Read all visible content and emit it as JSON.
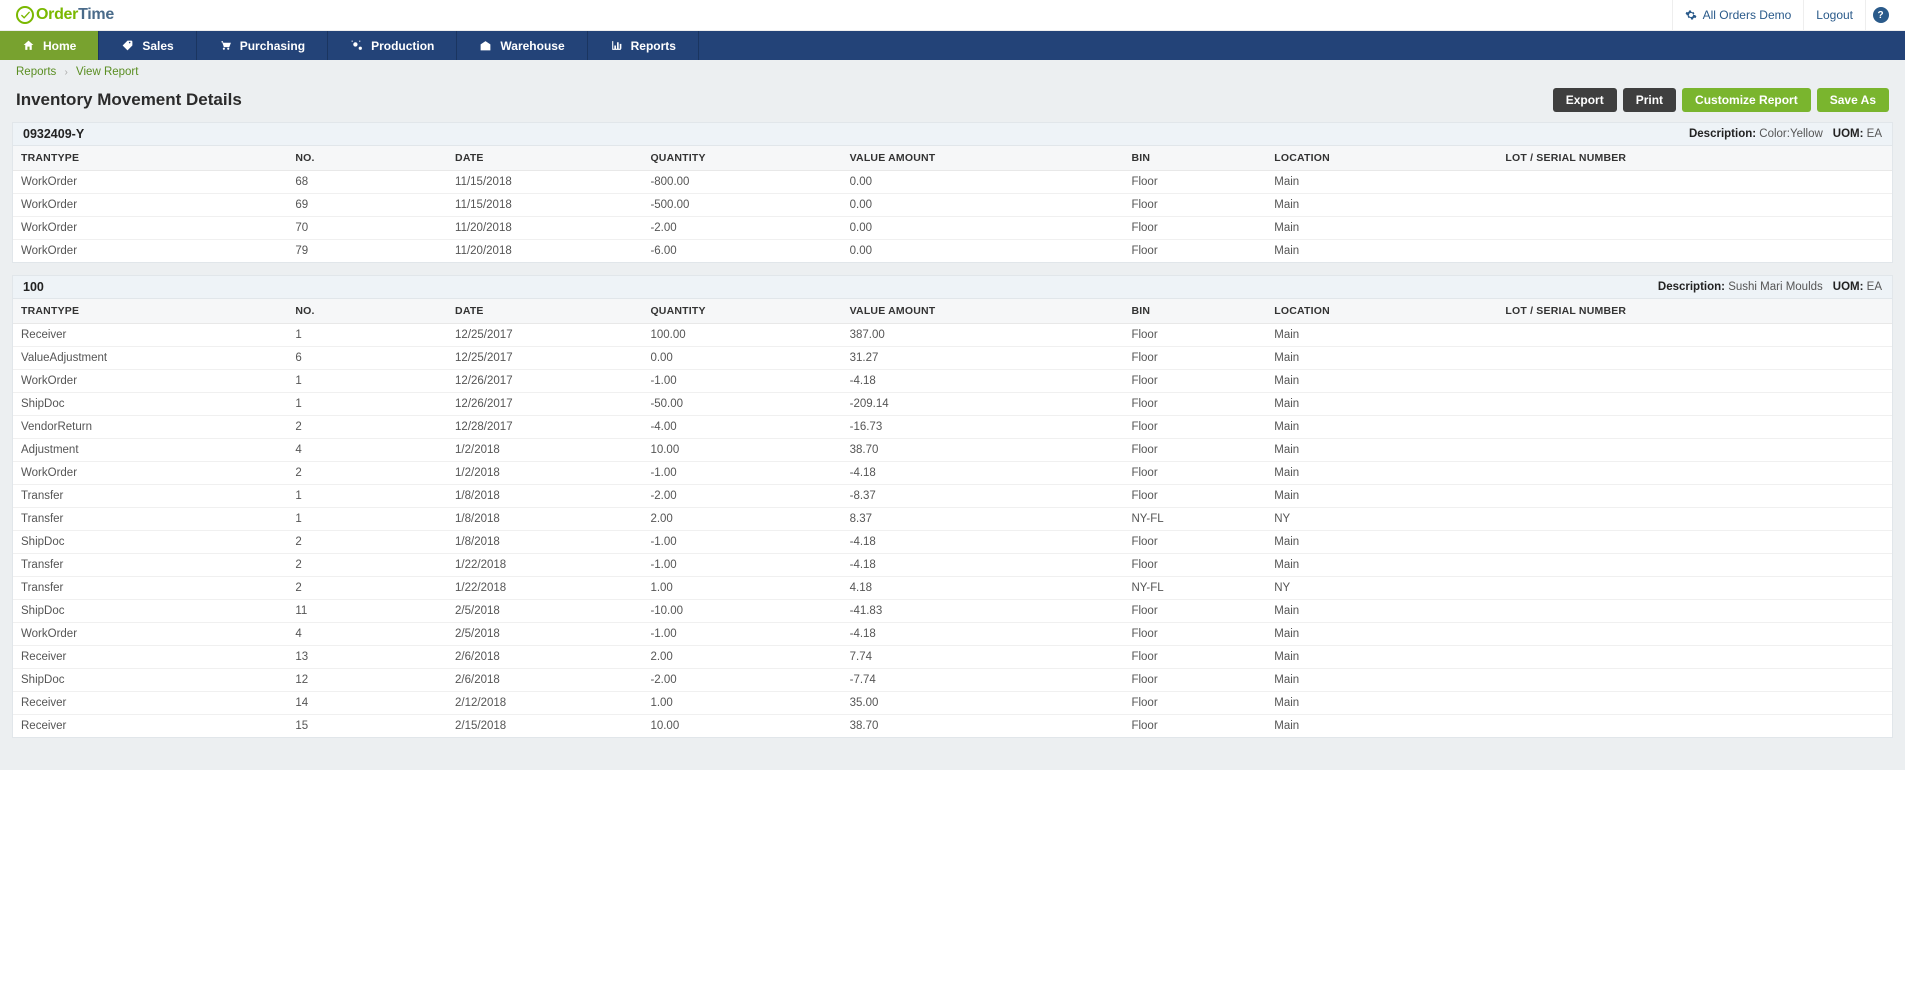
{
  "brand": {
    "part1": "Order",
    "part2": "Time"
  },
  "header": {
    "demo_label": "All Orders Demo",
    "logout_label": "Logout"
  },
  "nav": [
    {
      "id": "home",
      "label": "Home",
      "icon": "home",
      "active": true
    },
    {
      "id": "sales",
      "label": "Sales",
      "icon": "tag",
      "active": false
    },
    {
      "id": "purchasing",
      "label": "Purchasing",
      "icon": "cart",
      "active": false
    },
    {
      "id": "production",
      "label": "Production",
      "icon": "gears",
      "active": false
    },
    {
      "id": "warehouse",
      "label": "Warehouse",
      "icon": "warehouse",
      "active": false
    },
    {
      "id": "reports",
      "label": "Reports",
      "icon": "chart",
      "active": false
    }
  ],
  "breadcrumb": {
    "root": "Reports",
    "current": "View Report"
  },
  "page_title": "Inventory Movement Details",
  "buttons": {
    "export": "Export",
    "print": "Print",
    "customize": "Customize Report",
    "save_as": "Save As"
  },
  "columns": {
    "trantype": "TRANTYPE",
    "no": "NO.",
    "date": "DATE",
    "qty": "QUANTITY",
    "val": "VALUE AMOUNT",
    "bin": "BIN",
    "loc": "LOCATION",
    "lot": "LOT / SERIAL NUMBER"
  },
  "labels": {
    "description": "Description:",
    "uom": "UOM:"
  },
  "sections": [
    {
      "code": "0932409-Y",
      "description": "Color:Yellow",
      "uom": "EA",
      "rows": [
        {
          "trantype": "WorkOrder",
          "no": "68",
          "date": "11/15/2018",
          "qty": "-800.00",
          "val": "0.00",
          "bin": "Floor",
          "loc": "Main",
          "lot": ""
        },
        {
          "trantype": "WorkOrder",
          "no": "69",
          "date": "11/15/2018",
          "qty": "-500.00",
          "val": "0.00",
          "bin": "Floor",
          "loc": "Main",
          "lot": ""
        },
        {
          "trantype": "WorkOrder",
          "no": "70",
          "date": "11/20/2018",
          "qty": "-2.00",
          "val": "0.00",
          "bin": "Floor",
          "loc": "Main",
          "lot": ""
        },
        {
          "trantype": "WorkOrder",
          "no": "79",
          "date": "11/20/2018",
          "qty": "-6.00",
          "val": "0.00",
          "bin": "Floor",
          "loc": "Main",
          "lot": ""
        }
      ]
    },
    {
      "code": "100",
      "description": "Sushi Mari Moulds",
      "uom": "EA",
      "rows": [
        {
          "trantype": "Receiver",
          "no": "1",
          "date": "12/25/2017",
          "qty": "100.00",
          "val": "387.00",
          "bin": "Floor",
          "loc": "Main",
          "lot": ""
        },
        {
          "trantype": "ValueAdjustment",
          "no": "6",
          "date": "12/25/2017",
          "qty": "0.00",
          "val": "31.27",
          "bin": "Floor",
          "loc": "Main",
          "lot": ""
        },
        {
          "trantype": "WorkOrder",
          "no": "1",
          "date": "12/26/2017",
          "qty": "-1.00",
          "val": "-4.18",
          "bin": "Floor",
          "loc": "Main",
          "lot": ""
        },
        {
          "trantype": "ShipDoc",
          "no": "1",
          "date": "12/26/2017",
          "qty": "-50.00",
          "val": "-209.14",
          "bin": "Floor",
          "loc": "Main",
          "lot": ""
        },
        {
          "trantype": "VendorReturn",
          "no": "2",
          "date": "12/28/2017",
          "qty": "-4.00",
          "val": "-16.73",
          "bin": "Floor",
          "loc": "Main",
          "lot": ""
        },
        {
          "trantype": "Adjustment",
          "no": "4",
          "date": "1/2/2018",
          "qty": "10.00",
          "val": "38.70",
          "bin": "Floor",
          "loc": "Main",
          "lot": ""
        },
        {
          "trantype": "WorkOrder",
          "no": "2",
          "date": "1/2/2018",
          "qty": "-1.00",
          "val": "-4.18",
          "bin": "Floor",
          "loc": "Main",
          "lot": ""
        },
        {
          "trantype": "Transfer",
          "no": "1",
          "date": "1/8/2018",
          "qty": "-2.00",
          "val": "-8.37",
          "bin": "Floor",
          "loc": "Main",
          "lot": ""
        },
        {
          "trantype": "Transfer",
          "no": "1",
          "date": "1/8/2018",
          "qty": "2.00",
          "val": "8.37",
          "bin": "NY-FL",
          "loc": "NY",
          "lot": ""
        },
        {
          "trantype": "ShipDoc",
          "no": "2",
          "date": "1/8/2018",
          "qty": "-1.00",
          "val": "-4.18",
          "bin": "Floor",
          "loc": "Main",
          "lot": ""
        },
        {
          "trantype": "Transfer",
          "no": "2",
          "date": "1/22/2018",
          "qty": "-1.00",
          "val": "-4.18",
          "bin": "Floor",
          "loc": "Main",
          "lot": ""
        },
        {
          "trantype": "Transfer",
          "no": "2",
          "date": "1/22/2018",
          "qty": "1.00",
          "val": "4.18",
          "bin": "NY-FL",
          "loc": "NY",
          "lot": ""
        },
        {
          "trantype": "ShipDoc",
          "no": "11",
          "date": "2/5/2018",
          "qty": "-10.00",
          "val": "-41.83",
          "bin": "Floor",
          "loc": "Main",
          "lot": ""
        },
        {
          "trantype": "WorkOrder",
          "no": "4",
          "date": "2/5/2018",
          "qty": "-1.00",
          "val": "-4.18",
          "bin": "Floor",
          "loc": "Main",
          "lot": ""
        },
        {
          "trantype": "Receiver",
          "no": "13",
          "date": "2/6/2018",
          "qty": "2.00",
          "val": "7.74",
          "bin": "Floor",
          "loc": "Main",
          "lot": ""
        },
        {
          "trantype": "ShipDoc",
          "no": "12",
          "date": "2/6/2018",
          "qty": "-2.00",
          "val": "-7.74",
          "bin": "Floor",
          "loc": "Main",
          "lot": ""
        },
        {
          "trantype": "Receiver",
          "no": "14",
          "date": "2/12/2018",
          "qty": "1.00",
          "val": "35.00",
          "bin": "Floor",
          "loc": "Main",
          "lot": ""
        },
        {
          "trantype": "Receiver",
          "no": "15",
          "date": "2/15/2018",
          "qty": "10.00",
          "val": "38.70",
          "bin": "Floor",
          "loc": "Main",
          "lot": ""
        }
      ]
    }
  ]
}
